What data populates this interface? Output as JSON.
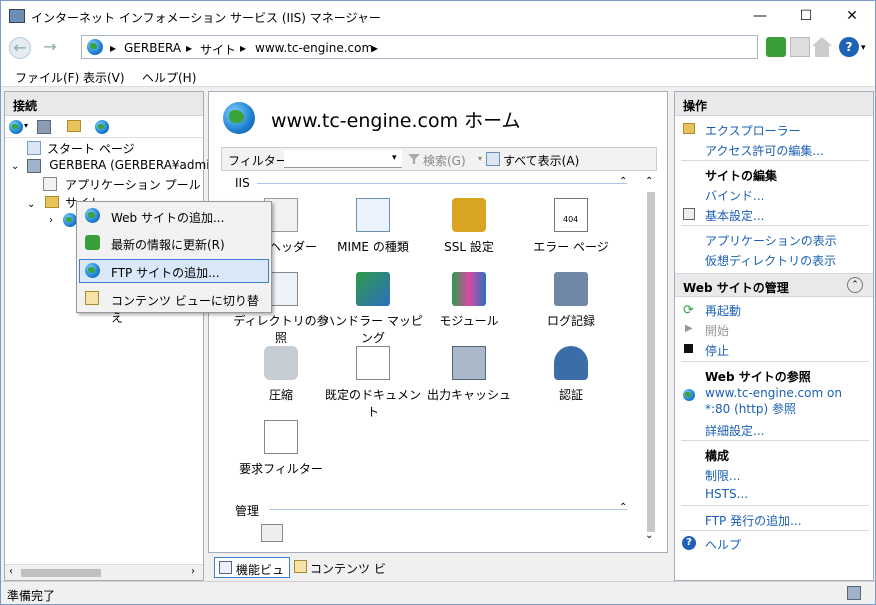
{
  "window": {
    "title": "インターネット インフォメーション サービス (IIS) マネージャー",
    "minimize": "—",
    "maximize": "☐",
    "close": "✕"
  },
  "address": {
    "crumbs": [
      "GERBERA",
      "サイト",
      "www.tc-engine.com"
    ],
    "sep": "▸"
  },
  "menu": [
    "ファイル(F)",
    "表示(V)",
    "ヘルプ(H)"
  ],
  "connections": {
    "header": "接続",
    "tree": [
      "スタート ページ",
      "GERBERA (GERBERA¥adminku",
      "アプリケーション プール",
      "サイト"
    ]
  },
  "context_menu": {
    "items": [
      "Web サイトの追加...",
      "最新の情報に更新(R)",
      "FTP サイトの追加...",
      "コンテンツ ビューに切り替え"
    ],
    "selected_index": 2
  },
  "center": {
    "title": "www.tc-engine.com ホーム",
    "filter_label": "フィルター:",
    "search_label": "検索(G)",
    "show_all_label": "すべて表示(A)",
    "group_iis": "IIS",
    "group_admin": "管理",
    "features": [
      "応答ヘッダー",
      "MIME の種類",
      "SSL 設定",
      "エラー ページ",
      "ディレクトリの参照",
      "ハンドラー マッピング",
      "モジュール",
      "ログ記録",
      "圧縮",
      "既定のドキュメント",
      "出力キャッシュ",
      "認証",
      "要求フィルター"
    ],
    "feature_view_tab": "機能ビュー",
    "content_view_tab": "コンテンツ ビュー"
  },
  "actions": {
    "header": "操作",
    "explore": "エクスプローラー",
    "edit_permissions": "アクセス許可の編集...",
    "edit_site_header": "サイトの編集",
    "bindings": "バインド...",
    "basic_settings": "基本設定...",
    "view_applications": "アプリケーションの表示",
    "view_vdirs": "仮想ディレクトリの表示",
    "manage_header": "Web サイトの管理",
    "restart": "再起動",
    "start": "開始",
    "stop": "停止",
    "browse_header": "Web サイトの参照",
    "browse_link": "www.tc-engine.com on *:80 (http) 参照",
    "advanced": "詳細設定...",
    "config_header": "構成",
    "limits": "制限...",
    "hsts": "HSTS...",
    "ftp_publish": "FTP 発行の追加...",
    "help": "ヘルプ"
  },
  "status": {
    "text": "準備完了"
  }
}
